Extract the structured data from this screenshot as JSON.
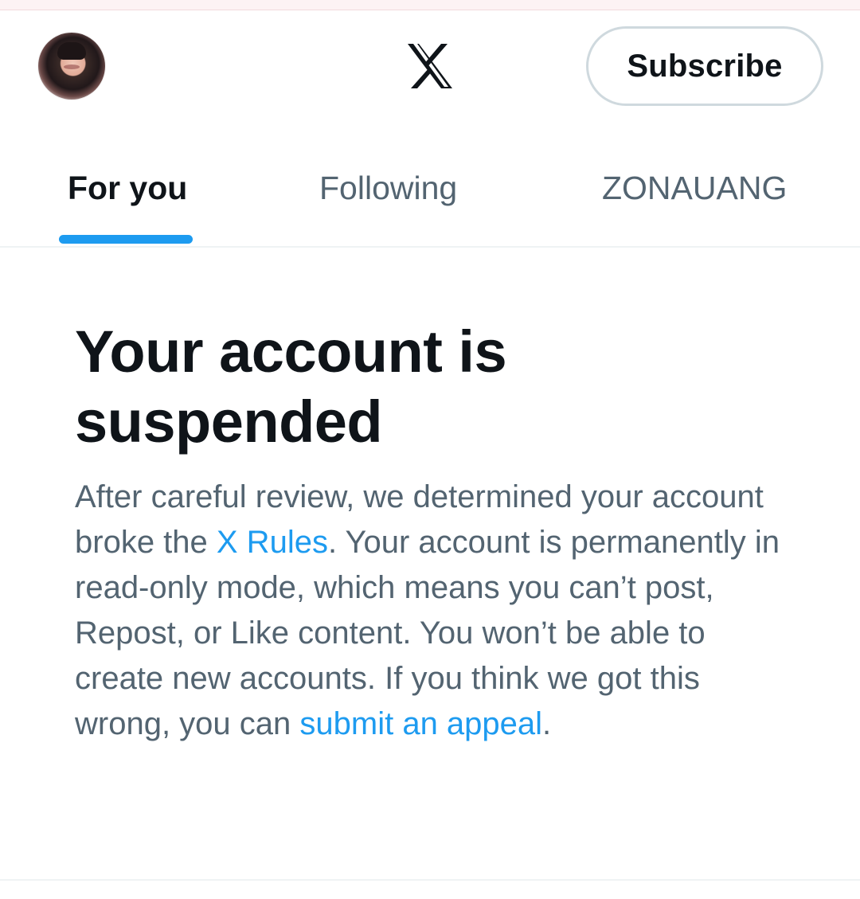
{
  "header": {
    "avatar_icon": "profile-avatar",
    "logo_icon": "x-logo-icon",
    "subscribe_label": "Subscribe"
  },
  "tabs": [
    {
      "label": "For you",
      "active": true
    },
    {
      "label": "Following",
      "active": false
    },
    {
      "label": "ZONAUANG",
      "active": false
    }
  ],
  "notice": {
    "title": "Your account is suspended",
    "text_1": "After careful review, we determined your account broke the ",
    "link_1": "X Rules",
    "text_2": ". Your account is permanently in read-only mode, which means you can’t post, Repost, or Like content. You won’t be able to create new accounts. If you think we got this wrong, you can ",
    "link_2": "submit an appeal",
    "text_3": "."
  },
  "colors": {
    "accent": "#1d9bf0",
    "text_primary": "#0f1419",
    "text_secondary": "#536471",
    "border": "#cfd9de"
  }
}
